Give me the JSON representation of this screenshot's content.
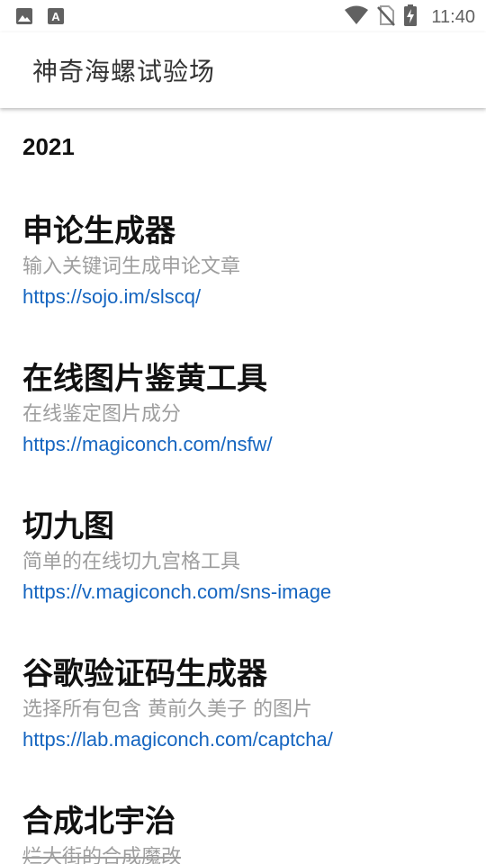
{
  "status_bar": {
    "time": "11:40",
    "left_icons": [
      "image-icon",
      "a-box-icon"
    ],
    "right_icons": [
      "wifi-icon",
      "no-sim-icon",
      "battery-charging-icon"
    ]
  },
  "app_bar": {
    "title": "神奇海螺试验场"
  },
  "content": {
    "year": "2021",
    "entries": [
      {
        "title": "申论生成器",
        "description": "输入关键词生成申论文章",
        "url": "https://sojo.im/slscq/"
      },
      {
        "title": "在线图片鉴黄工具",
        "description": "在线鉴定图片成分",
        "url": "https://magiconch.com/nsfw/"
      },
      {
        "title": "切九图",
        "description": "简单的在线切九宫格工具",
        "url": "https://v.magiconch.com/sns-image"
      },
      {
        "title": "谷歌验证码生成器",
        "description": "选择所有包含 黄前久美子 的图片",
        "url": "https://lab.magiconch.com/captcha/"
      },
      {
        "title": "合成北宇治",
        "description": "烂大街的合成魔改",
        "url": ""
      }
    ]
  },
  "colors": {
    "link": "#1565c0",
    "description": "#9e9e9e",
    "title": "#111111",
    "status_icons": "#616161"
  }
}
